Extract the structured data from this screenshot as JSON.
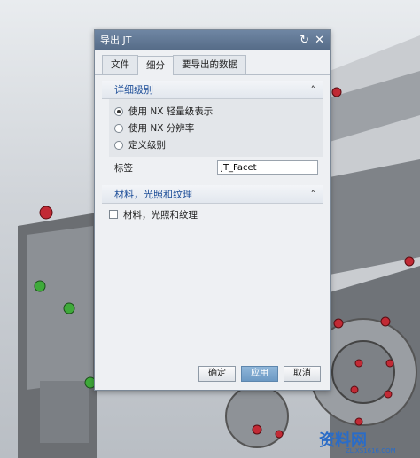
{
  "dialog": {
    "title": "导出 JT",
    "tabs": [
      "文件",
      "细分",
      "要导出的数据"
    ],
    "active_tab": 1
  },
  "section_detail": {
    "header": "详细级别",
    "options": [
      "使用 NX 轻量级表示",
      "使用 NX 分辨率",
      "定义级别"
    ],
    "selected": 0,
    "label_field": {
      "label": "标签",
      "value": "JT_Facet"
    }
  },
  "section_material": {
    "header": "材料，光照和纹理",
    "checkbox_label": "材料，光照和纹理",
    "checked": false
  },
  "buttons": {
    "ok": "确定",
    "apply": "应用",
    "cancel": "取消"
  },
  "watermark": {
    "main": "资料网",
    "sub": "ZL.XS1616.COM"
  }
}
